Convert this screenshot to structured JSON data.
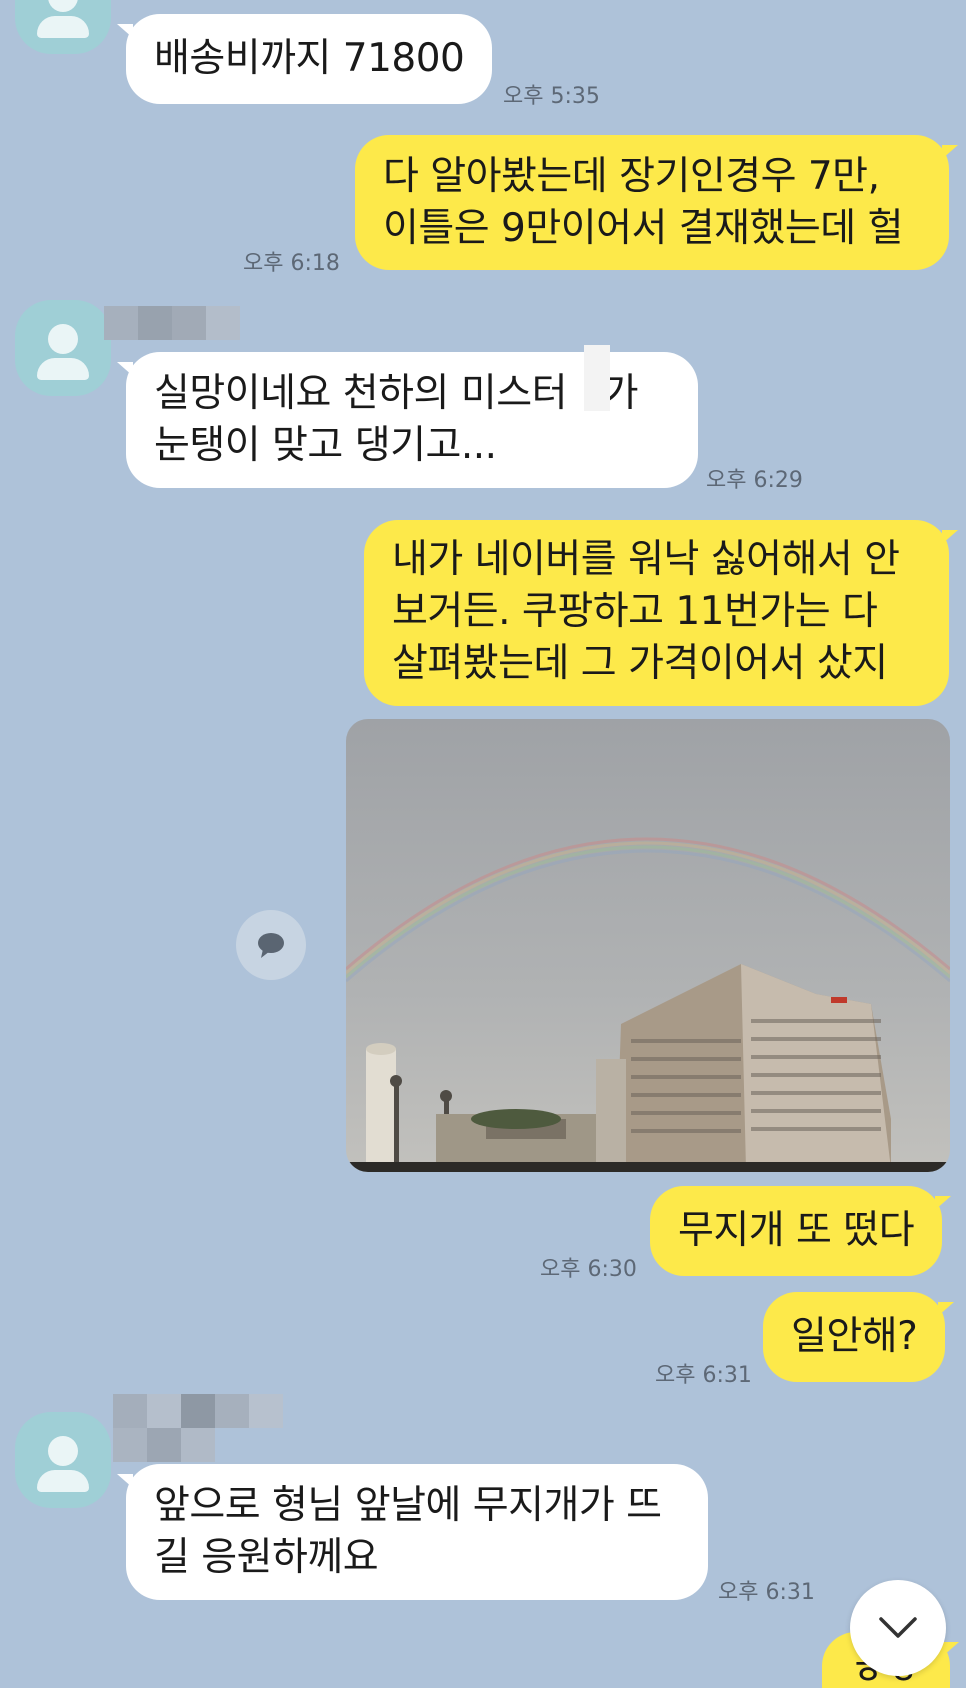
{
  "colors": {
    "background": "#aec2d9",
    "bubble_in": "#ffffff",
    "bubble_out": "#fde94a",
    "avatar": "#9fcfd6"
  },
  "messages": [
    {
      "id": "m1",
      "side": "incoming",
      "text": "배송비까지 71800",
      "time": "오후 5:35"
    },
    {
      "id": "m2",
      "side": "outgoing",
      "text": "다 알아봤는데 장기인경우 7만,\n이틀은 9만이어서 결재했는데 헐",
      "time": "오후 6:18"
    },
    {
      "id": "m3",
      "side": "incoming",
      "text": "실망이네요 천하의 미스터   가\n눈탱이 맞고 댕기고...",
      "time": "오후 6:29"
    },
    {
      "id": "m4",
      "side": "outgoing",
      "text": "내가 네이버를 워낙 싫어해서 안\n보거든. 쿠팡하고 11번가는 다\n살펴봤는데 그 가격이어서 샀지",
      "time": ""
    },
    {
      "id": "m5",
      "side": "outgoing",
      "type": "photo",
      "icon": "rainbow-photo"
    },
    {
      "id": "m6",
      "side": "outgoing",
      "text": "무지개 또 떴다",
      "time": "오후 6:30"
    },
    {
      "id": "m7",
      "side": "outgoing",
      "text": "일안해?",
      "time": "오후 6:31"
    },
    {
      "id": "m8",
      "side": "incoming",
      "text": "앞으로 형님 앞날에 무지개가 뜨\n길 응원하께요",
      "time": "오후 6:31"
    },
    {
      "id": "m9",
      "side": "outgoing",
      "text": "ㅎㅎ",
      "time": ""
    }
  ],
  "icons": {
    "share": "speech-bubble-icon",
    "scroll": "chevron-down-icon",
    "avatar": "default-profile-icon"
  }
}
